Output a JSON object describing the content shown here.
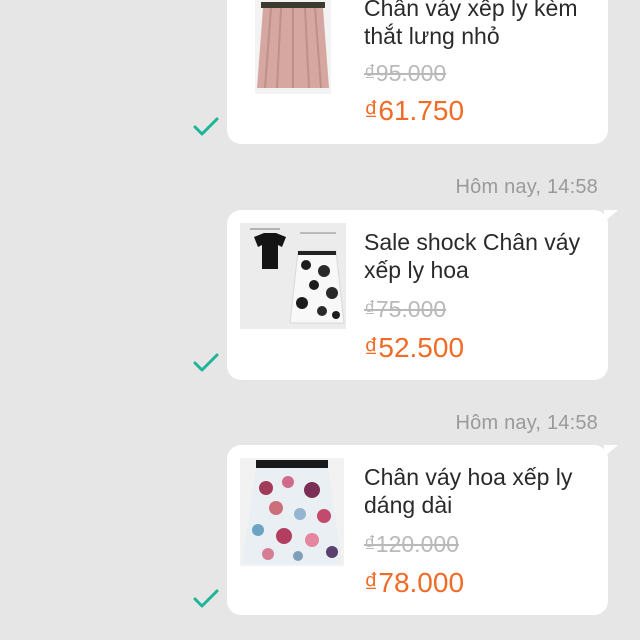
{
  "messages": [
    {
      "timestamp": "",
      "title": "Chân váy xếp ly kèm thắt lưng nhỏ",
      "old_price": "₫95.000",
      "new_price": "₫61.750",
      "image_icon": "pink-pleated-skirt-image",
      "read_icon": "check-icon"
    },
    {
      "timestamp": "Hôm nay, 14:58",
      "title": "Sale shock Chân váy xếp ly hoa",
      "old_price": "₫75.000",
      "new_price": "₫52.500",
      "image_icon": "crop-top-floral-skirt-image",
      "read_icon": "check-icon"
    },
    {
      "timestamp": "Hôm nay, 14:58",
      "title": "Chân váy hoa xếp ly dáng dài",
      "old_price": "₫120.000",
      "new_price": "₫78.000",
      "image_icon": "floral-long-skirt-image",
      "read_icon": "check-icon"
    }
  ],
  "colors": {
    "background": "#e6e6e6",
    "bubble": "#ffffff",
    "price_accent": "#f06b26",
    "check": "#1fb59a",
    "timestamp": "#9a9a9a"
  }
}
